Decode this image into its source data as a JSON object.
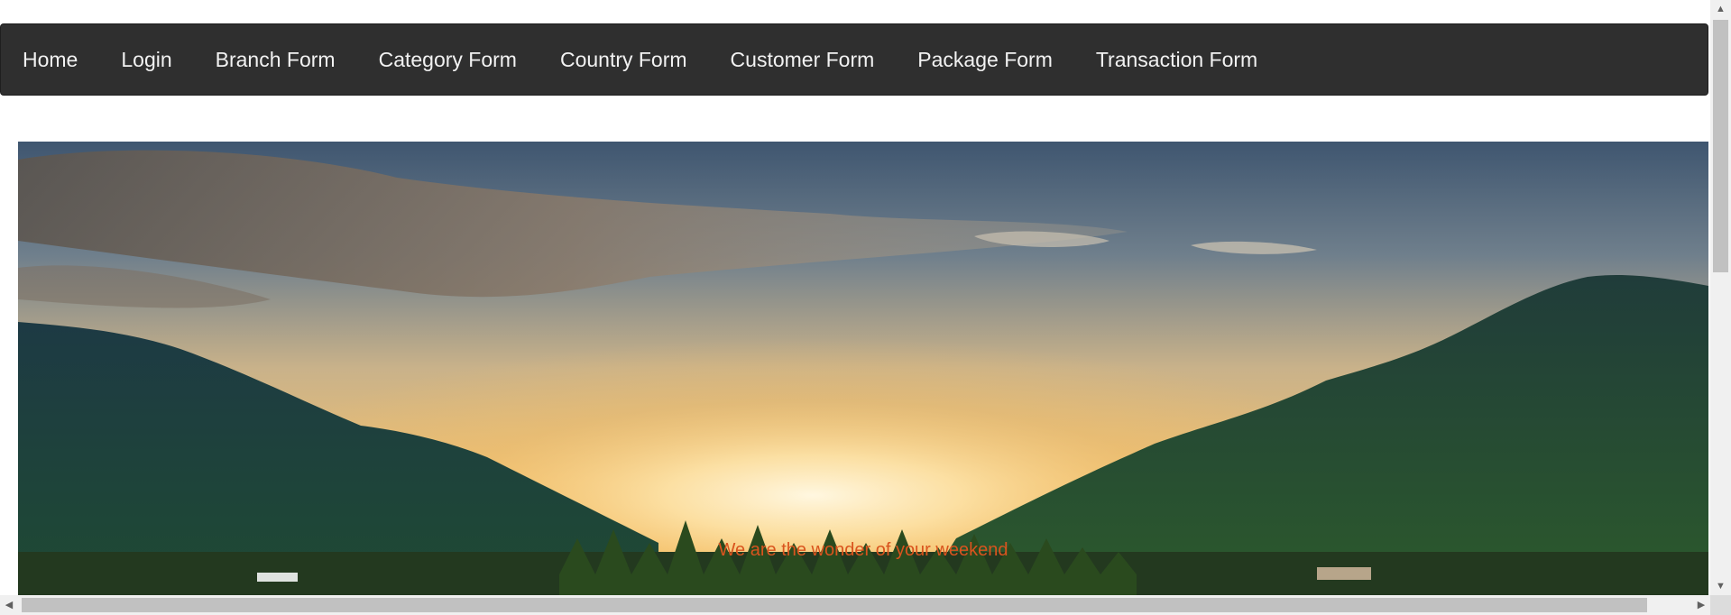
{
  "nav": {
    "items": [
      {
        "label": "Home"
      },
      {
        "label": "Login"
      },
      {
        "label": "Branch Form"
      },
      {
        "label": "Category Form"
      },
      {
        "label": "Country Form"
      },
      {
        "label": "Customer Form"
      },
      {
        "label": "Package Form"
      },
      {
        "label": "Transaction Form"
      }
    ],
    "background": "#2f2f2f",
    "text_color": "#f2f2f2"
  },
  "hero": {
    "image": "sunset-valley-landscape",
    "caption": "We are the wonder of your weekend",
    "caption_color": "#d9541e"
  },
  "scrollbars": {
    "up_arrow": "▲",
    "down_arrow": "▼",
    "left_arrow": "◀",
    "right_arrow": "▶"
  }
}
